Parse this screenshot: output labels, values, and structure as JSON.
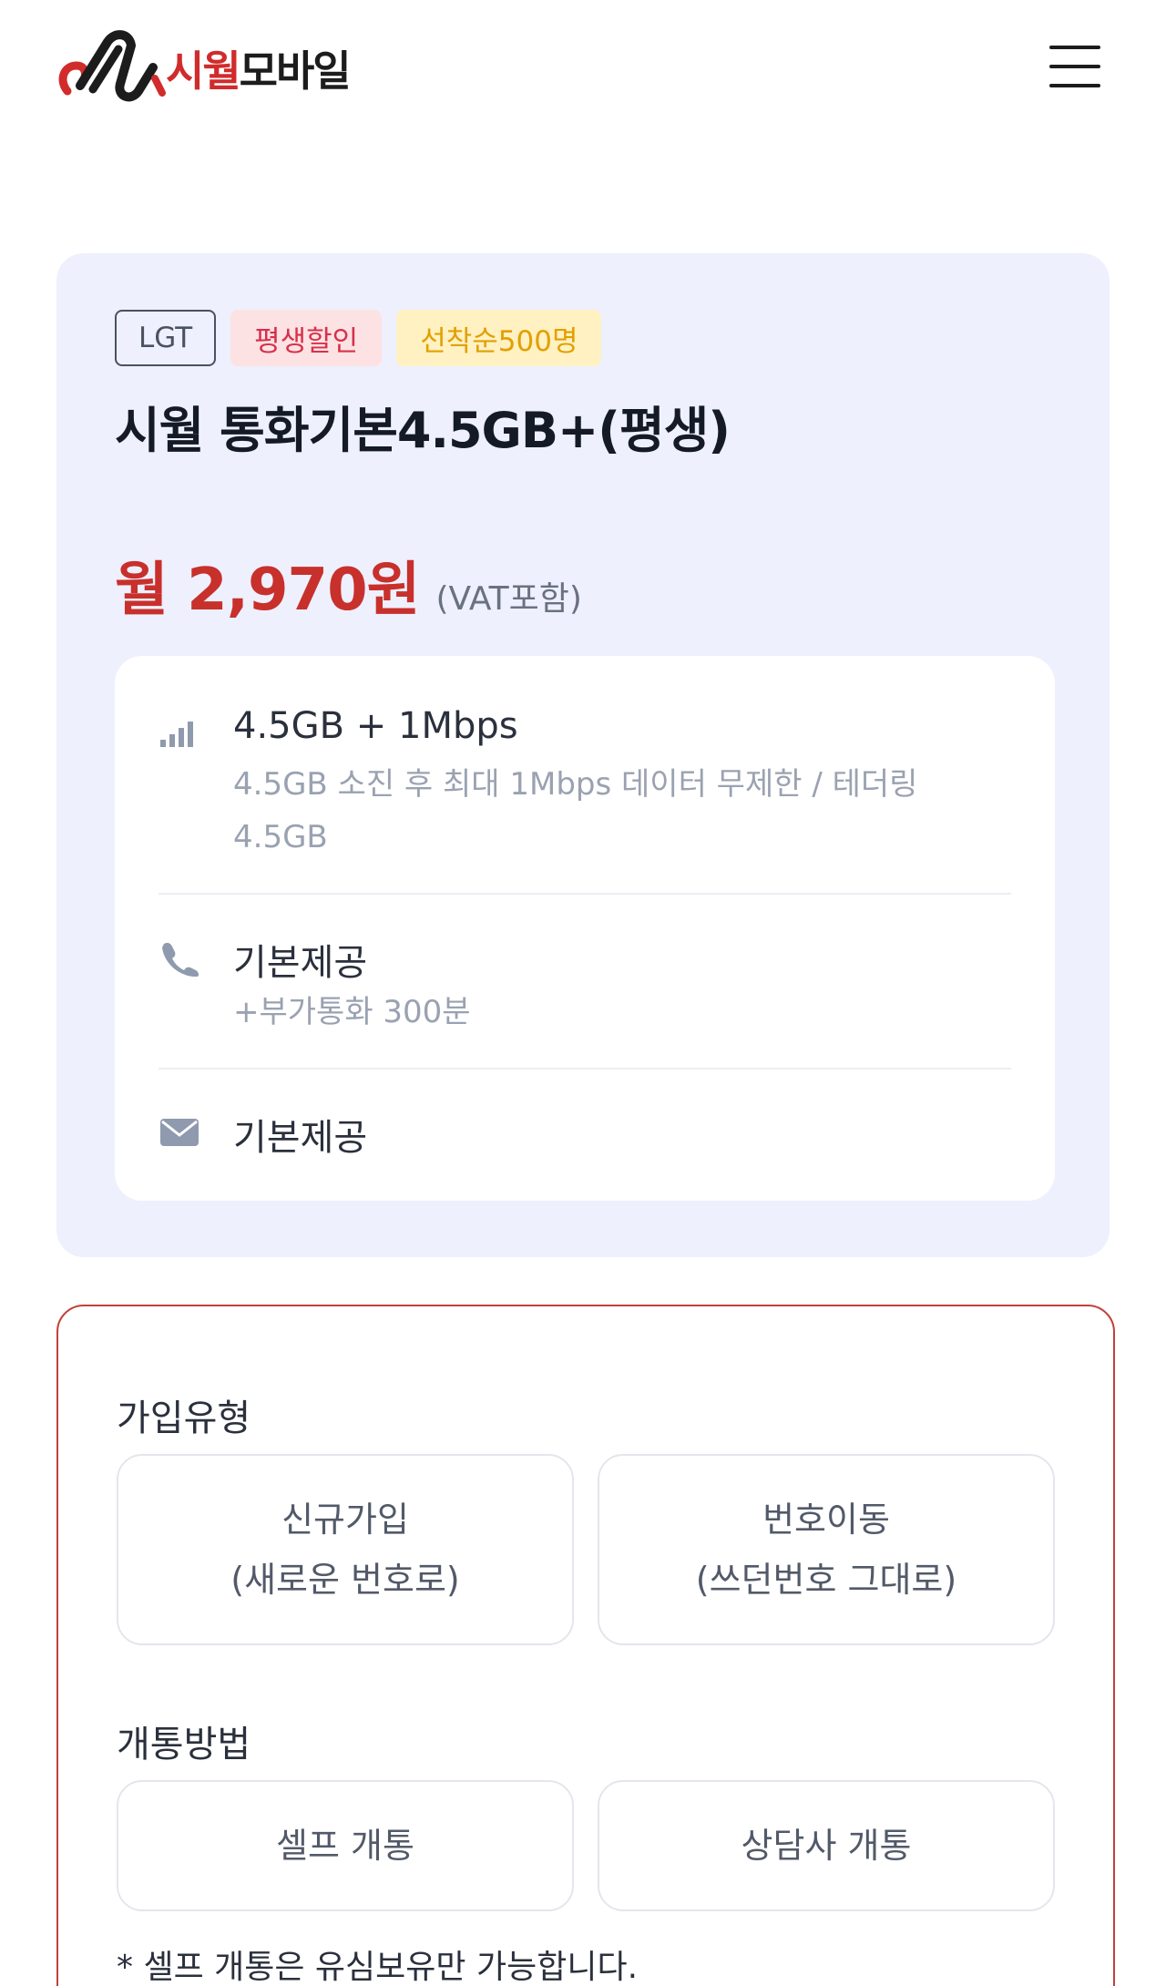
{
  "header": {
    "brand_part1": "시월",
    "brand_part2": "모바일",
    "logo_icon": "siwol-logo-icon",
    "menu_icon": "hamburger-menu-icon"
  },
  "plan": {
    "badges": [
      "LGT",
      "평생할인",
      "선착순500명"
    ],
    "title": "시월 통화기본4.5GB+(평생)",
    "price": "월 2,970원",
    "vat_note": "(VAT포함)",
    "features": [
      {
        "icon": "signal-bars-icon",
        "title": "4.5GB + 1Mbps",
        "desc": "4.5GB 소진 후 최대 1Mbps 데이터 무제한 / 테더링 4.5GB"
      },
      {
        "icon": "phone-icon",
        "title": "기본제공",
        "desc": "+부가통화 300분"
      },
      {
        "icon": "envelope-icon",
        "title": "기본제공",
        "desc": ""
      }
    ]
  },
  "subscription": {
    "join_type_label": "가입유형",
    "join_options": [
      {
        "line1": "신규가입",
        "line2": "(새로운 번호로)"
      },
      {
        "line1": "번호이동",
        "line2": "(쓰던번호 그대로)"
      }
    ],
    "activation_label": "개통방법",
    "activation_options": [
      "셀프 개통",
      "상담사 개통"
    ],
    "note": "* 셀프 개통은 유심보유만 가능합니다."
  },
  "colors": {
    "accent_red": "#c8302c",
    "card_bg": "#eef0fd",
    "badge_pink_bg": "#fde2e4",
    "badge_yellow_bg": "#fff1c2"
  }
}
